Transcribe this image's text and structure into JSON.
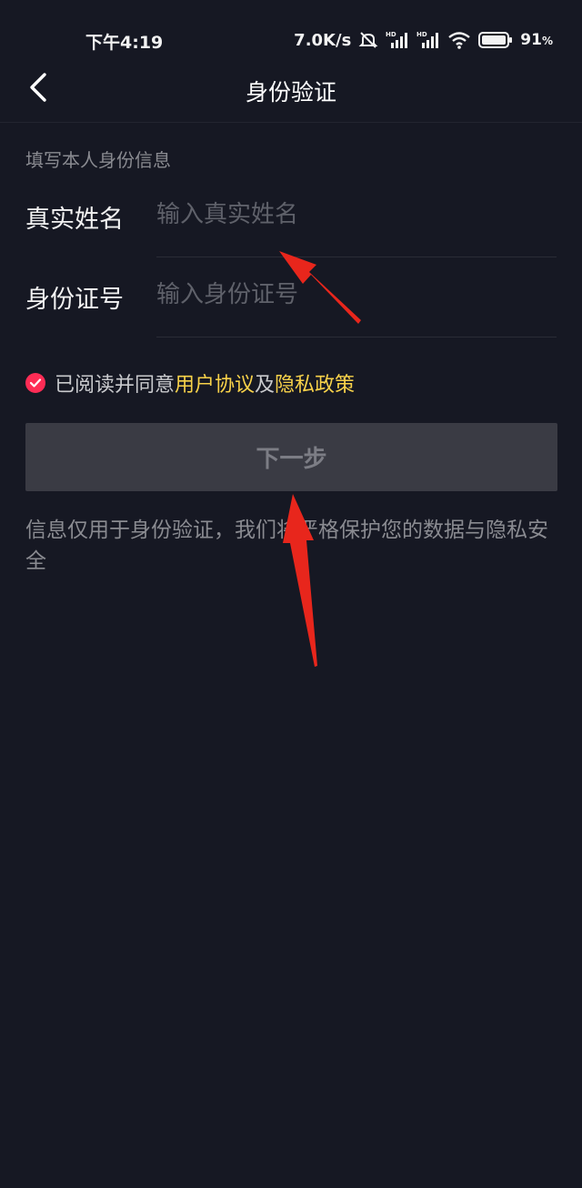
{
  "status_bar": {
    "time": "下午4:19",
    "network_speed": "7.0K/s",
    "battery": "91",
    "battery_suffix": "%"
  },
  "nav": {
    "title": "身份验证",
    "back_icon": "chevron-left-icon"
  },
  "form": {
    "section_hint": "填写本人身份信息",
    "name_label": "真实姓名",
    "name_placeholder": "输入真实姓名",
    "name_value": "",
    "id_label": "身份证号",
    "id_placeholder": "输入身份证号",
    "id_value": ""
  },
  "agreement": {
    "checked": true,
    "prefix": "已阅读并同意",
    "user_agreement": "用户协议",
    "conjunction": "及",
    "privacy_policy": "隐私政策"
  },
  "next_button": {
    "label": "下一步",
    "enabled": false
  },
  "privacy_note": "信息仅用于身份验证，我们将严格保护您的数据与隐私安全",
  "colors": {
    "background": "#161823",
    "accent": "#fe2c55",
    "link": "#f8d24a",
    "button_disabled": "#3a3b44",
    "annotation_arrow": "#e8261c"
  }
}
